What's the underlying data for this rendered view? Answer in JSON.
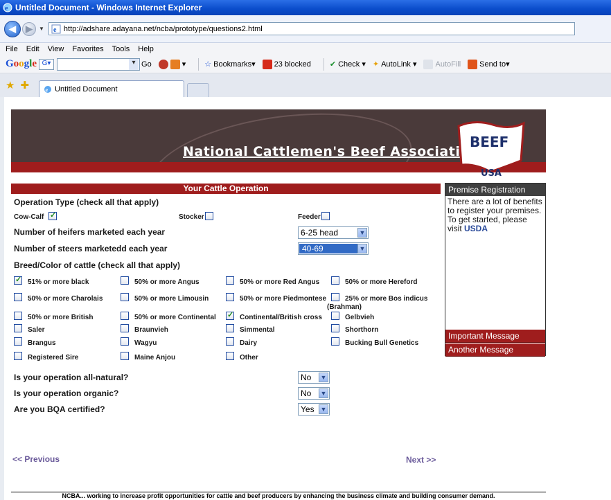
{
  "window": {
    "title": "Untitled Document - Windows Internet Explorer"
  },
  "address": {
    "url": "http://adshare.adayana.net/ncba/prototype/questions2.html"
  },
  "menu": [
    "File",
    "Edit",
    "View",
    "Favorites",
    "Tools",
    "Help"
  ],
  "google_toolbar": {
    "go": "Go",
    "bookmarks": "Bookmarks",
    "blocked": "23 blocked",
    "check": "Check",
    "autolink": "AutoLink",
    "autofill": "AutoFill",
    "send_to": "Send to"
  },
  "tabs": [
    {
      "label": "Untitled Document"
    }
  ],
  "banner": {
    "association": "National Cattlemen's Beef Association",
    "logo_top": "BEEF",
    "logo_bottom": "USA"
  },
  "section": {
    "title": "Your Cattle Operation"
  },
  "operation_type": {
    "label": "Operation Type (check all that apply)",
    "options": [
      {
        "label": "Cow-Calf",
        "checked": true
      },
      {
        "label": "Stocker",
        "checked": false
      },
      {
        "label": "Feeder",
        "checked": false
      }
    ]
  },
  "heifers": {
    "label": "Number of heifers marketed each year",
    "value": "6-25 head"
  },
  "steers": {
    "label": "Number of steers marketedd each year",
    "value": "40-69"
  },
  "breed": {
    "label": "Breed/Color of cattle (check all that apply)",
    "options": [
      {
        "label": "51% or more black",
        "checked": true
      },
      {
        "label": "50% or more Angus",
        "checked": false
      },
      {
        "label": "50% or more Red Angus",
        "checked": false
      },
      {
        "label": "50% or more Hereford",
        "checked": false
      },
      {
        "label": "50% or more Charolais",
        "checked": false
      },
      {
        "label": "50% or more Limousin",
        "checked": false
      },
      {
        "label": "50% or more Piedmontese",
        "checked": false
      },
      {
        "label": "25% or more Bos indicus",
        "label2": "(Brahman)",
        "checked": false
      },
      {
        "label": "50% or more British",
        "checked": false
      },
      {
        "label": "50% or more Continental",
        "checked": false
      },
      {
        "label": "Continental/British cross",
        "checked": true
      },
      {
        "label": "Gelbvieh",
        "checked": false
      },
      {
        "label": "Saler",
        "checked": false
      },
      {
        "label": "Braunvieh",
        "checked": false
      },
      {
        "label": "Simmental",
        "checked": false
      },
      {
        "label": "Shorthorn",
        "checked": false
      },
      {
        "label": "Brangus",
        "checked": false
      },
      {
        "label": "Wagyu",
        "checked": false
      },
      {
        "label": "Dairy",
        "checked": false
      },
      {
        "label": "Bucking Bull Genetics",
        "checked": false
      },
      {
        "label": "Registered Sire",
        "checked": false
      },
      {
        "label": "Maine Anjou",
        "checked": false
      },
      {
        "label": "Other",
        "checked": false
      }
    ]
  },
  "natural": {
    "label": "Is your operation all-natural?",
    "value": "No"
  },
  "organic": {
    "label": "Is your operation organic?",
    "value": "No"
  },
  "bqa": {
    "label": "Are you BQA certified?",
    "value": "Yes"
  },
  "navigation": {
    "previous": "<< Previous",
    "next": "Next >>"
  },
  "sidebar": {
    "title": "Premise Registration",
    "text": "There are a lot of benefits to register your premises. To get started, please visit",
    "link": "USDA",
    "messages": [
      "Important Message",
      "Another Message"
    ]
  },
  "footer": {
    "text": "NCBA... working to increase profit opportunities for cattle and beef producers by enhancing the business climate and building consumer demand."
  },
  "colors": {
    "brand_red": "#9f1d1d",
    "banner_brown": "#4a3a3a"
  }
}
